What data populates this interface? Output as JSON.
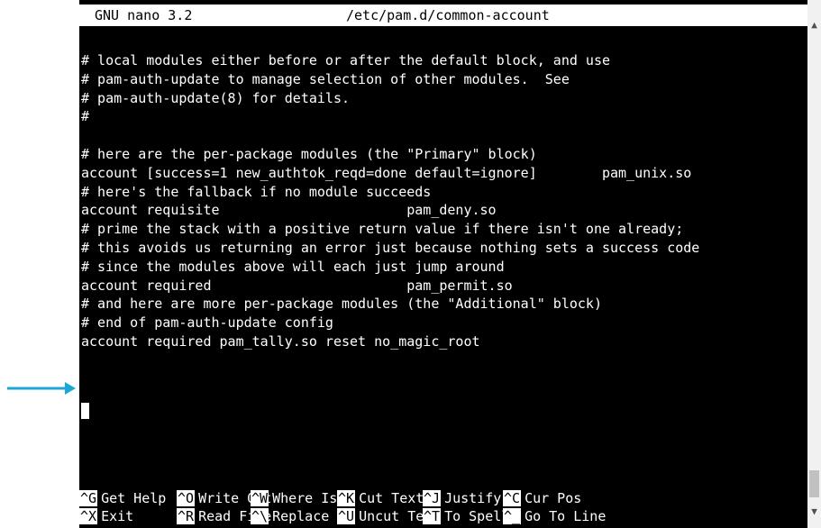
{
  "titlebar": {
    "app": "GNU nano 3.2",
    "file": "/etc/pam.d/common-account"
  },
  "editor_lines": [
    "# local modules either before or after the default block, and use",
    "# pam-auth-update to manage selection of other modules.  See",
    "# pam-auth-update(8) for details.",
    "#",
    "",
    "# here are the per-package modules (the \"Primary\" block)",
    "account [success=1 new_authtok_reqd=done default=ignore]        pam_unix.so",
    "# here's the fallback if no module succeeds",
    "account requisite                       pam_deny.so",
    "# prime the stack with a positive return value if there isn't one already;",
    "# this avoids us returning an error just because nothing sets a success code",
    "# since the modules above will each just jump around",
    "account required                        pam_permit.so",
    "# and here are more per-package modules (the \"Additional\" block)",
    "# end of pam-auth-update config",
    "account required pam_tally.so reset no_magic_root"
  ],
  "shortcuts": {
    "row1": [
      {
        "key": "^G",
        "label": "Get Help"
      },
      {
        "key": "^O",
        "label": "Write Out"
      },
      {
        "key": "^W",
        "label": "Where Is"
      },
      {
        "key": "^K",
        "label": "Cut Text"
      },
      {
        "key": "^J",
        "label": "Justify"
      },
      {
        "key": "^C",
        "label": "Cur Pos"
      }
    ],
    "row2": [
      {
        "key": "^X",
        "label": "Exit"
      },
      {
        "key": "^R",
        "label": "Read File"
      },
      {
        "key": "^\\",
        "label": "Replace"
      },
      {
        "key": "^U",
        "label": "Uncut Text"
      },
      {
        "key": "^T",
        "label": "To Spell"
      },
      {
        "key": "^_",
        "label": "Go To Line"
      }
    ]
  },
  "scrollbar": {
    "up_icon": "chevron-up-icon",
    "down_icon": "chevron-down-icon"
  },
  "annotation": {
    "arrow_color": "#1ea7d6"
  }
}
